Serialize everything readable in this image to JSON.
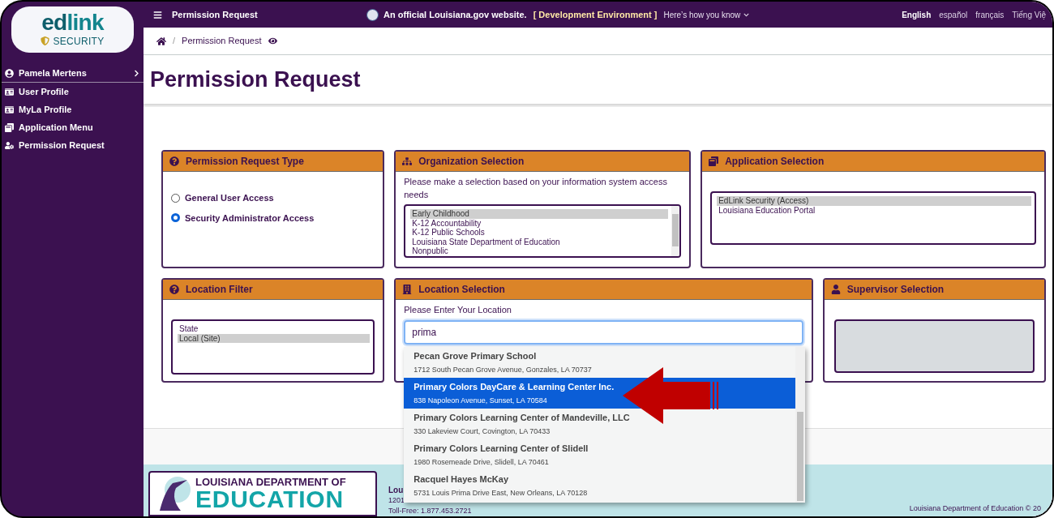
{
  "logo": {
    "word_1": "ed",
    "word_2": "link",
    "tagline": "SECURITY"
  },
  "sidebar": {
    "user": "Pamela Mertens",
    "items": [
      {
        "label": "User Profile",
        "kind": "card"
      },
      {
        "label": "MyLa Profile",
        "kind": "card"
      },
      {
        "label": "Application Menu",
        "kind": "windows"
      },
      {
        "label": "Permission Request",
        "kind": "user"
      }
    ]
  },
  "topbar": {
    "title": "Permission Request",
    "official": "An official Louisiana.gov website.",
    "environment": "[ Development Environment ]",
    "how": "Here’s how you know",
    "languages": [
      {
        "label": "English",
        "selected": true
      },
      {
        "label": "español",
        "selected": false
      },
      {
        "label": "français",
        "selected": false
      },
      {
        "label": "Tiếng Việ",
        "selected": false
      }
    ]
  },
  "breadcrumb": {
    "separator": "/",
    "current": "Permission Request"
  },
  "page_title": "Permission Request",
  "request_type": {
    "title": "Permission Request Type",
    "options": [
      {
        "label": "General User Access",
        "selected": false
      },
      {
        "label": "Security Administrator Access",
        "selected": true
      }
    ]
  },
  "organization": {
    "title": "Organization Selection",
    "hint": "Please make a selection based on your information system access needs",
    "options": [
      {
        "label": "Early Childhood",
        "selected": true
      },
      {
        "label": "K-12 Accountability",
        "selected": false
      },
      {
        "label": "K-12 Public Schools",
        "selected": false
      },
      {
        "label": "Louisiana State Department of Education",
        "selected": false
      },
      {
        "label": "Nonpublic",
        "selected": false
      }
    ]
  },
  "application": {
    "title": "Application Selection",
    "options": [
      {
        "label": "EdLink Security (Access)",
        "selected": true
      },
      {
        "label": "Louisiana Education Portal",
        "selected": false
      }
    ]
  },
  "location_filter": {
    "title": "Location Filter",
    "options": [
      {
        "label": "State",
        "selected": false
      },
      {
        "label": "Local (Site)",
        "selected": true
      }
    ]
  },
  "location": {
    "title": "Location Selection",
    "label": "Please Enter Your Location",
    "value": "prima",
    "results": [
      {
        "name": "Pecan Grove Primary School",
        "address": "1712 South Pecan Grove Avenue, Gonzales, LA 70737",
        "selected": false
      },
      {
        "name": "Primary Colors DayCare & Learning Center Inc.",
        "address": "838 Napoleon Avenue, Sunset, LA 70584",
        "selected": true
      },
      {
        "name": "Primary Colors Learning Center of Mandeville, LLC",
        "address": "330 Lakeview Court, Covington, LA 70433",
        "selected": false
      },
      {
        "name": "Primary Colors Learning Center of Slidell",
        "address": "1980 Rosemeade Drive, Slidell, LA 70461",
        "selected": false
      },
      {
        "name": "Racquel Hayes McKay",
        "address": "5731 Louis Prima Drive East, New Orleans, LA 70128",
        "selected": false
      }
    ]
  },
  "supervisor": {
    "title": "Supervisor Selection"
  },
  "footer": {
    "logo_line_1": "LOUISIANA DEPARTMENT OF",
    "logo_line_2": "EDUCATION",
    "lines": [
      "Lou",
      "1201",
      "Toll-Free: 1.877.453.2721"
    ],
    "copyright": "Louisiana Department of Education © 20"
  }
}
